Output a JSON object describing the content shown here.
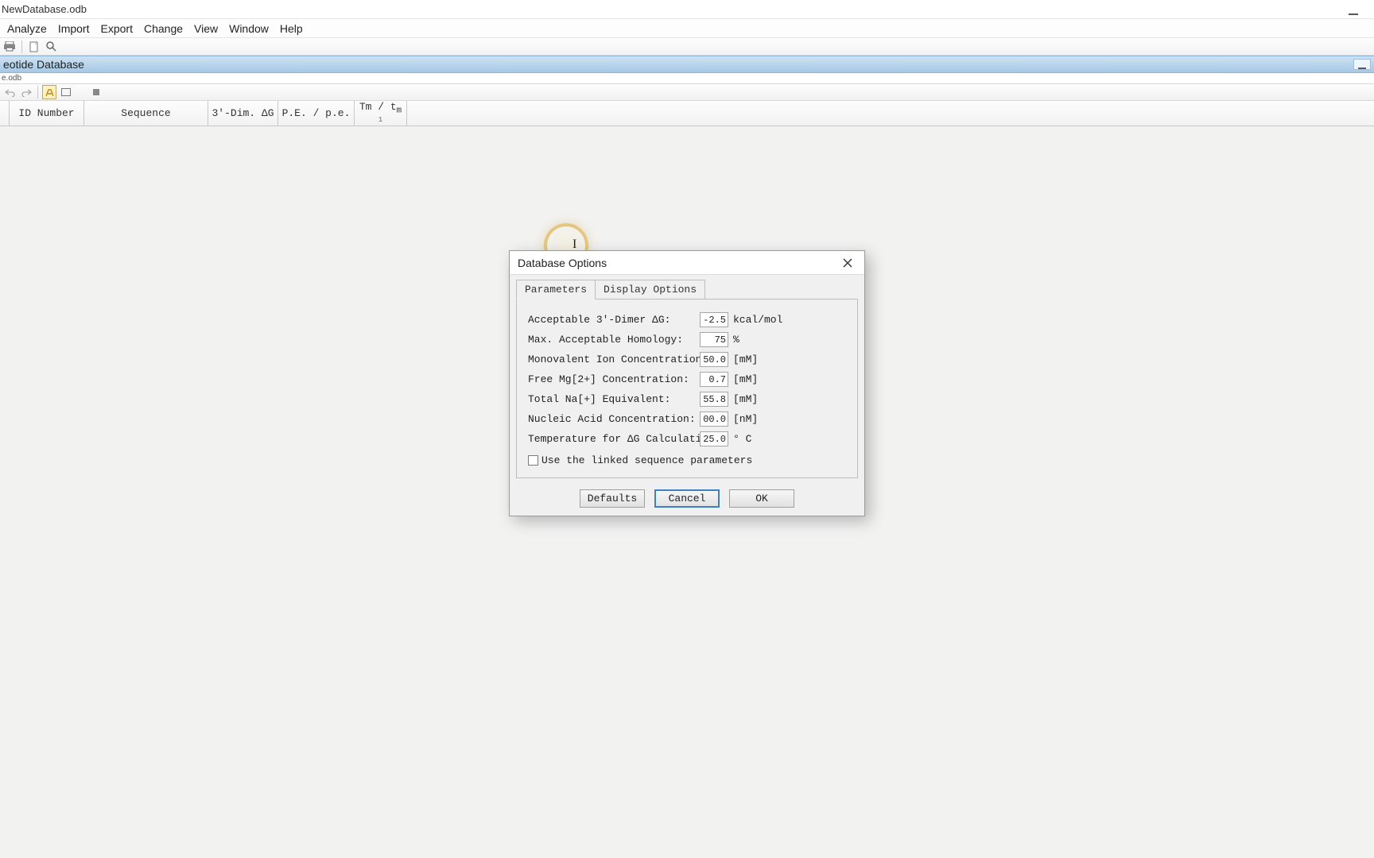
{
  "window": {
    "title": "NewDatabase.odb"
  },
  "menus": [
    "Analyze",
    "Import",
    "Export",
    "Change",
    "View",
    "Window",
    "Help"
  ],
  "subwindow": {
    "title": "eotide Database",
    "path": "e.odb"
  },
  "columns": {
    "id": "ID Number",
    "sequence": "Sequence",
    "dimer": "3'-Dim. ΔG",
    "pe": "P.E. / p.e.",
    "tm_top": "Tm / t",
    "tm_sub_m": "m",
    "tm_bottom": "1"
  },
  "dialog": {
    "title": "Database Options",
    "tabs": {
      "parameters": "Parameters",
      "display": "Display Options"
    },
    "params": {
      "dimer_label": "Acceptable 3'-Dimer ΔG:",
      "dimer_value": "-2.5",
      "dimer_unit": "kcal/mol",
      "homology_label": "Max. Acceptable Homology:",
      "homology_value": "75",
      "homology_unit": "%",
      "mono_label": "Monovalent Ion Concentration:",
      "mono_value": "50.0",
      "mono_unit": "[mM]",
      "mg_label": "Free Mg[2+] Concentration:",
      "mg_value": "0.7",
      "mg_unit": "[mM]",
      "na_label": "Total Na[+] Equivalent:",
      "na_value": "55.8",
      "na_unit": "[mM]",
      "nucleic_label": "Nucleic Acid Concentration:",
      "nucleic_value": "00.0",
      "nucleic_unit": "[nM]",
      "temp_label": "Temperature for ΔG Calculations:",
      "temp_value": "25.0",
      "temp_unit": "° C",
      "checkbox_label": "Use the linked sequence parameters"
    },
    "buttons": {
      "defaults": "Defaults",
      "cancel": "Cancel",
      "ok": "OK"
    }
  }
}
